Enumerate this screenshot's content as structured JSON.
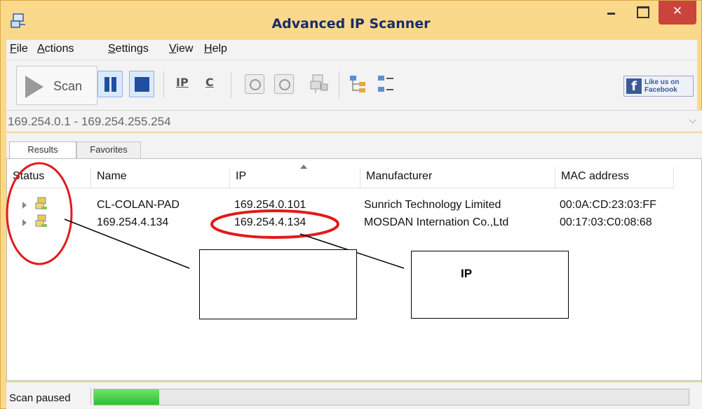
{
  "window": {
    "title": "Advanced IP Scanner",
    "close_glyph": "✕"
  },
  "menu": [
    {
      "label_u": "F",
      "label_rest": "ile"
    },
    {
      "label_u": "A",
      "label_rest": "ctions"
    },
    {
      "label_u": "S",
      "label_rest": "ettings"
    },
    {
      "label_u": "V",
      "label_rest": "iew"
    },
    {
      "label_u": "H",
      "label_rest": "elp"
    }
  ],
  "toolbar": {
    "scan_label": "Scan",
    "ip_label": "IP",
    "c_label": "C",
    "facebook_line1": "Like us on",
    "facebook_line2": "Facebook",
    "facebook_f": "f"
  },
  "range": {
    "value": "169.254.0.1 - 169.254.255.254",
    "dropdown_glyph": "⌵"
  },
  "tabs": [
    {
      "label": "Results",
      "active": true
    },
    {
      "label": "Favorites",
      "active": false
    }
  ],
  "columns": [
    "Status",
    "Name",
    "IP",
    "Manufacturer",
    "MAC address"
  ],
  "rows": [
    {
      "name": "CL-COLAN-PAD",
      "ip": "169.254.0.101",
      "manufacturer": "Sunrich Technology Limited",
      "mac": "00:0A:CD:23:03:FF"
    },
    {
      "name": "169.254.4.134",
      "ip": "169.254.4.134",
      "manufacturer": "MOSDAN Internation Co.,Ltd",
      "mac": "00:17:03:C0:08:68"
    }
  ],
  "status": {
    "text": "Scan paused",
    "progress_fraction": 0.11
  },
  "annotations": {
    "right_box_label": "IP",
    "highlight_color": "#e11b1b"
  },
  "colors": {
    "title_bar": "#fbd98a",
    "close_button": "#c9443a",
    "progress": "#2fbf2f",
    "toolbar_blue": "#1f4fa0"
  }
}
